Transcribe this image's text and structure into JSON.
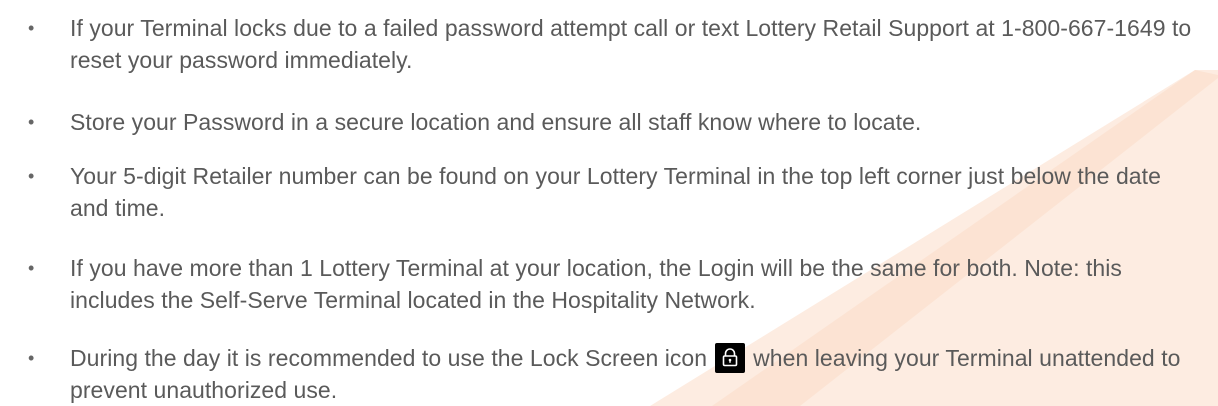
{
  "colors": {
    "text": "#5a5a5a",
    "accent_wedge": "#fde9dc",
    "accent_stripe": "#fbd9c3",
    "icon_bg": "#000000"
  },
  "bullets": [
    {
      "text": "If your Terminal locks due to a failed password attempt call or text Lottery Retail Support at 1-800-667-1649 to reset your password immediately."
    },
    {
      "text": "Store your Password in a secure location and ensure all staff know where to locate."
    },
    {
      "text": "Your 5-digit Retailer number can be found on your Lottery Terminal in the top left corner just below the date and time."
    },
    {
      "text": "If you have more than 1 Lottery Terminal at your location, the Login will be the same for both. Note: this includes the Self-Serve Terminal located in the Hospitality Network."
    },
    {
      "text_before_icon": "During the day it is recommended to use the Lock Screen icon",
      "icon": "lock-icon",
      "text_after_icon": "when leaving your Terminal unattended to prevent unauthorized use."
    }
  ],
  "bullet_symbol": "•"
}
